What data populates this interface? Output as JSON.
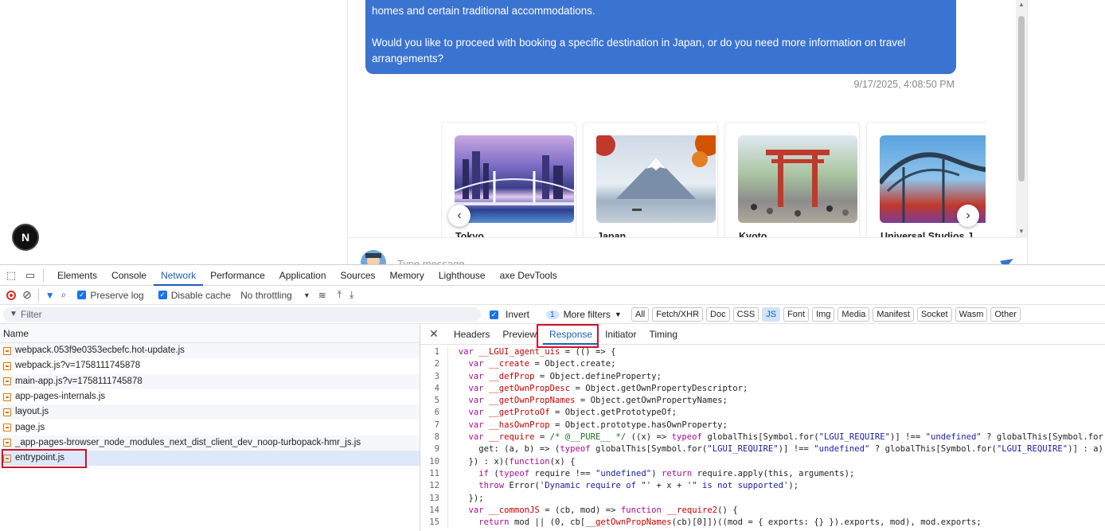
{
  "chat": {
    "bubble_line1": "homes and certain traditional accommodations.",
    "bubble_line2": "Would you like to proceed with booking a specific destination in Japan, or do you need more information on travel",
    "bubble_line3": "arrangements?",
    "timestamp": "9/17/2025, 4:08:50 PM",
    "cards": [
      {
        "name": "Tokyo",
        "image": "tokyo-night-bridge"
      },
      {
        "name": "Japan",
        "image": "mount-fuji"
      },
      {
        "name": "Kyoto",
        "image": "torii-gate"
      },
      {
        "name": "Universal Studios J",
        "image": "roller-coaster"
      }
    ],
    "input_placeholder": "Type message...",
    "next_badge": "N"
  },
  "devtools": {
    "tabs": [
      "Elements",
      "Console",
      "Network",
      "Performance",
      "Application",
      "Sources",
      "Memory",
      "Lighthouse",
      "axe DevTools"
    ],
    "active_tab": "Network",
    "toolbar": {
      "preserve_log": "Preserve log",
      "disable_cache": "Disable cache",
      "throttling": "No throttling"
    },
    "filter": {
      "placeholder": "Filter",
      "invert": "Invert",
      "more_filters_count": "1",
      "more_filters": "More filters",
      "chips": [
        "All",
        "Fetch/XHR",
        "Doc",
        "CSS",
        "JS",
        "Font",
        "Img",
        "Media",
        "Manifest",
        "Socket",
        "Wasm",
        "Other"
      ],
      "active_chip": "JS"
    },
    "requests_header": "Name",
    "requests": [
      "webpack.053f9e0353ecbefc.hot-update.js",
      "webpack.js?v=1758111745878",
      "main-app.js?v=1758111745878",
      "app-pages-internals.js",
      "layout.js",
      "page.js",
      "_app-pages-browser_node_modules_next_dist_client_dev_noop-turbopack-hmr_js.js",
      "entrypoint.js"
    ],
    "selected_request": "entrypoint.js",
    "detail_tabs": [
      "Headers",
      "Preview",
      "Response",
      "Initiator",
      "Timing"
    ],
    "active_detail_tab": "Response",
    "code_lines": [
      "var __LGUI_agent_uis = (() => {",
      "  var __create = Object.create;",
      "  var __defProp = Object.defineProperty;",
      "  var __getOwnPropDesc = Object.getOwnPropertyDescriptor;",
      "  var __getOwnPropNames = Object.getOwnPropertyNames;",
      "  var __getProtoOf = Object.getPrototypeOf;",
      "  var __hasOwnProp = Object.prototype.hasOwnProperty;",
      "  var __require = /* @__PURE__ */ ((x) => typeof globalThis[Symbol.for(\"LGUI_REQUIRE\")] !== \"undefined\" ? globalThis[Symbol.for(\"LGUI_R",
      "    get: (a, b) => (typeof globalThis[Symbol.for(\"LGUI_REQUIRE\")] !== \"undefined\" ? globalThis[Symbol.for(\"LGUI_REQUIRE\")] : a)[b]",
      "  }) : x)(function(x) {",
      "    if (typeof require !== \"undefined\") return require.apply(this, arguments);",
      "    throw Error('Dynamic require of \"' + x + '\" is not supported');",
      "  });",
      "  var __commonJS = (cb, mod) => function __require2() {",
      "    return mod || (0, cb[__getOwnPropNames(cb)[0]])((mod = { exports: {} }).exports, mod), mod.exports;"
    ]
  }
}
